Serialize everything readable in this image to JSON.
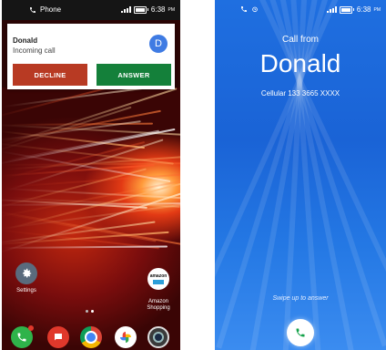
{
  "left_screen": {
    "status_bar": {
      "app_label": "Phone",
      "time": "6:38",
      "ampm": "PM"
    },
    "notification": {
      "caller": "Donald",
      "subtitle": "Incoming call",
      "avatar_letter": "D",
      "decline_label": "DECLINE",
      "answer_label": "ANSWER"
    },
    "home_icons": [
      {
        "label": "Settings",
        "icon": "settings-icon"
      },
      {
        "label": "Amazon\nShopping",
        "icon": "amazon-icon",
        "brand_text": "amazon"
      }
    ],
    "dock": [
      {
        "icon": "phone-icon",
        "color": "#2fb34a"
      },
      {
        "icon": "messages-icon",
        "color": "#e0382b"
      },
      {
        "icon": "chrome-icon",
        "color": "#ffffff"
      },
      {
        "icon": "photos-icon",
        "color": "#ffffff"
      },
      {
        "icon": "camera-icon",
        "color": "#3a3a3a"
      }
    ]
  },
  "right_screen": {
    "status_bar": {
      "time": "6:38",
      "ampm": "PM"
    },
    "call_from_label": "Call from",
    "caller_name": "Donald",
    "number_line": "Cellular 133 3665 XXXX",
    "swipe_hint": "Swipe up to answer",
    "answer_icon": "phone-icon"
  },
  "colors": {
    "decline": "#b83a23",
    "answer": "#14803a",
    "avatar": "#3f7be3",
    "call_bg": "#1f6fe0"
  }
}
